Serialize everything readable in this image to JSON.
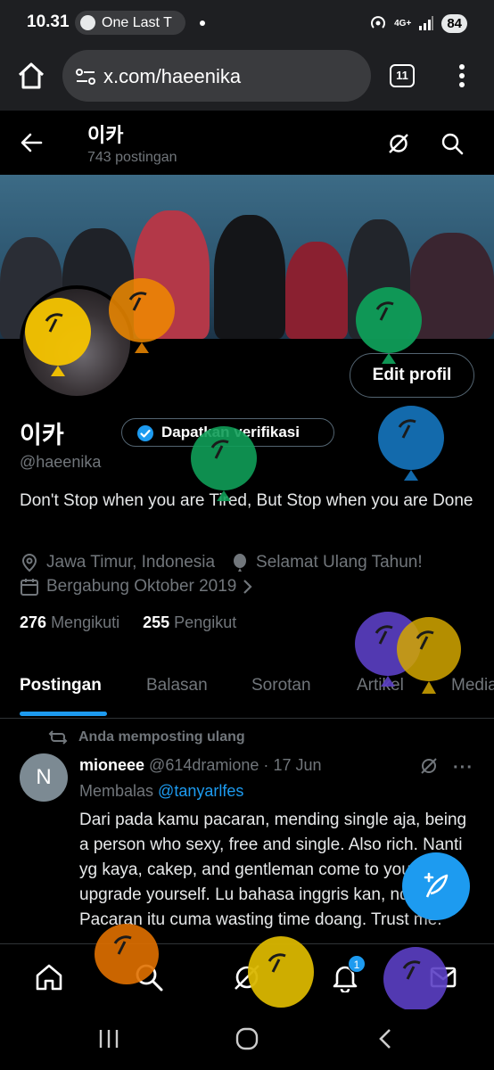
{
  "status_bar": {
    "time": "10.31",
    "media_title": "One Last T",
    "network": "4G+",
    "battery": "84"
  },
  "browser": {
    "url": "x.com/haeenika",
    "tab_count": "11"
  },
  "header": {
    "name": "이카",
    "post_count": "743 postingan"
  },
  "profile": {
    "name": "이카",
    "verify_label": "Dapatkan verifikasi",
    "handle": "@haeenika",
    "edit_label": "Edit profil",
    "bio": "Don't Stop when you are Tired, But Stop when you are Done",
    "location": "Jawa Timur, Indonesia",
    "birthday": "Selamat Ulang Tahun!",
    "joined": "Bergabung Oktober 2019",
    "following_count": "276",
    "following_label": "Mengikuti",
    "followers_count": "255",
    "followers_label": "Pengikut"
  },
  "tabs": [
    {
      "label": "Postingan",
      "active": true
    },
    {
      "label": "Balasan"
    },
    {
      "label": "Sorotan"
    },
    {
      "label": "Artikel"
    },
    {
      "label": "Media"
    }
  ],
  "post": {
    "repost_label": "Anda memposting ulang",
    "avatar_letter": "N",
    "author": "mioneee",
    "handle": "@614dramione",
    "separator": "·",
    "date": "17 Jun",
    "reply_prefix": "Membalas",
    "reply_to": "@tanyarlfes",
    "text": "Dari pada kamu pacaran, mending single aja, being a person who sexy, free and single. Also rich. Nanti yg kaya, cakep, and gentleman come to you if you upgrade yourself. Lu bahasa inggris kan, nder? Pacaran itu cuma wasting time doang. Trust me."
  },
  "notifications_badge": "1",
  "colors": {
    "accent": "#1d9bf0",
    "background": "#000000",
    "muted": "#71767b"
  },
  "balloon_colors": [
    "#f5c400",
    "#f08a00",
    "#0f9d58",
    "#1470b5",
    "#5b3fc4",
    "#d4a700",
    "#e07000",
    "#d9b600",
    "#5b3fc4"
  ]
}
